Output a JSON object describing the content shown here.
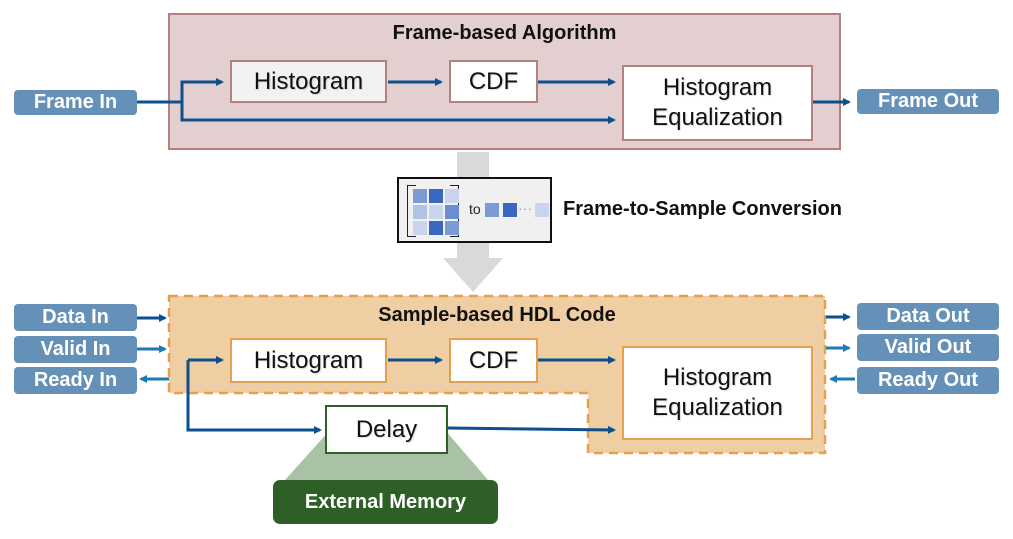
{
  "frame_section": {
    "title": "Frame-based Algorithm",
    "blocks": {
      "histogram": "Histogram",
      "cdf": "CDF",
      "equalization_line1": "Histogram",
      "equalization_line2": "Equalization"
    },
    "ports": {
      "input": "Frame In",
      "output": "Frame Out"
    }
  },
  "conversion": {
    "label": "Frame-to-Sample Conversion",
    "icon_text": "to",
    "ellipsis": "···"
  },
  "sample_section": {
    "title": "Sample-based HDL Code",
    "blocks": {
      "histogram": "Histogram",
      "cdf": "CDF",
      "equalization_line1": "Histogram",
      "equalization_line2": "Equalization",
      "delay": "Delay"
    },
    "inputs": [
      "Data In",
      "Valid In",
      "Ready In"
    ],
    "outputs": [
      "Data Out",
      "Valid Out",
      "Ready Out"
    ],
    "external_memory": "External Memory"
  },
  "colors": {
    "frame_fill": "#e3cfd0",
    "frame_border": "#b47f7f",
    "sample_fill": "#efcea4",
    "sample_border": "#e3a04e",
    "port_fill": "#6591b9",
    "wire": "#0e4f8d",
    "wire_light": "#1e7ab0",
    "memory_dark": "#2e5f27",
    "memory_light": "#a9c2a6",
    "block_arrow": "#d9d9d9"
  }
}
